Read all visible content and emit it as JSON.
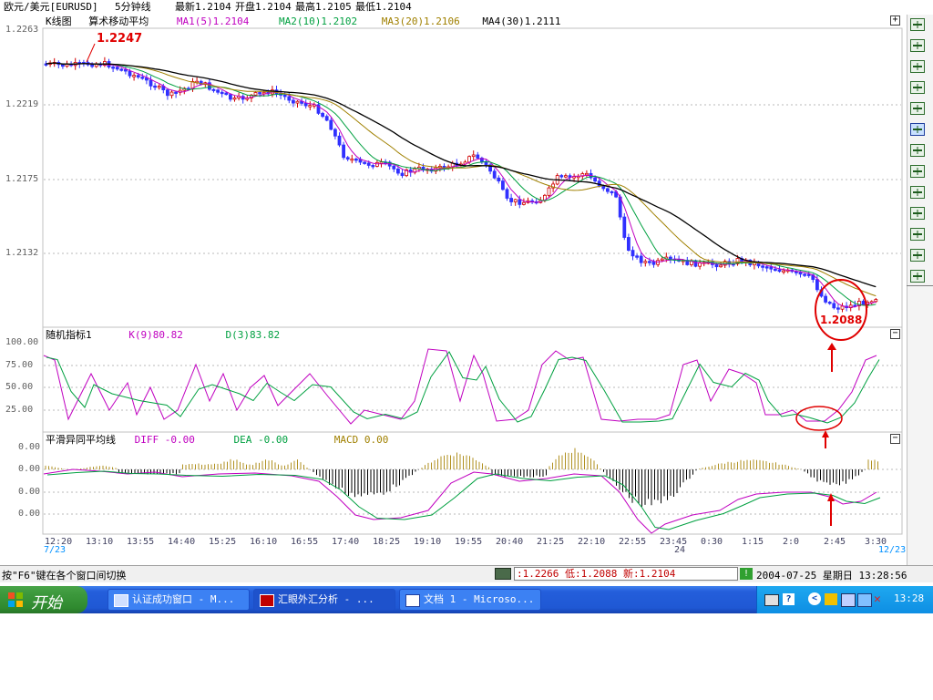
{
  "window": {
    "symbol": "欧元/美元[EURUSD]",
    "period": "5分钟线",
    "latest": "最新1.2104",
    "open": "开盘1.2104",
    "high": "最高1.2105",
    "low": "最低1.2104"
  },
  "kline": {
    "title": "K线图",
    "indicator": "算术移动平均",
    "ma1": "MA1(5)1.2104",
    "ma2": "MA2(10)1.2102",
    "ma3": "MA3(20)1.2106",
    "ma4": "MA4(30)1.2111",
    "annotation_high": "1.2247",
    "annotation_low": "1.2088",
    "y_ticks": [
      "1.2263",
      "1.2219",
      "1.2175",
      "1.2132"
    ]
  },
  "kdj": {
    "title": "随机指标1",
    "k": "K(9)80.82",
    "d": "D(3)83.82",
    "y_ticks": [
      "100.00",
      "75.00",
      "50.00",
      "25.00"
    ]
  },
  "macd": {
    "title": "平滑异同平均线",
    "diff": "DIFF -0.00",
    "dea": "DEA -0.00",
    "macd": "MACD 0.00",
    "y_ticks": [
      "0.00",
      "0.00",
      "0.00",
      "0.00"
    ]
  },
  "x_axis": {
    "labels": [
      "12:20",
      "13:10",
      "13:55",
      "14:40",
      "15:25",
      "16:10",
      "16:55",
      "17:40",
      "18:25",
      "19:10",
      "19:55",
      "20:40",
      "21:25",
      "22:10",
      "22:55",
      "23:45",
      "0:30",
      "1:15",
      "2:0",
      "2:45",
      "3:30"
    ],
    "date_start": "7/23",
    "date_mid": "24",
    "date_end": "12/23"
  },
  "status": {
    "hint": "按\"F6\"键在各个窗口间切换",
    "quote": ":1.2266 低:1.2088 新:1.2104",
    "datetime": "2004-07-25 星期日 13:28:56"
  },
  "taskbar": {
    "start": "开始",
    "tasks": [
      "认证成功窗口 - M...",
      "汇眼外汇分析 - ...",
      "文档 1 - Microso..."
    ],
    "clock": "13:28"
  },
  "colors": {
    "ma1": "#c000c0",
    "ma2": "#00a040",
    "ma3": "#a08000",
    "ma4": "#000000",
    "up": "#d00000",
    "down": "#3030ff",
    "annotation": "#e00000"
  },
  "icons": [
    "cursor-icon",
    "zoom-icon",
    "line-icon",
    "trend-icon",
    "channel-icon",
    "fib-icon",
    "pen-icon",
    "bars-icon",
    "candle-icon",
    "volume-icon",
    "grid-icon",
    "text-icon",
    "delete-icon"
  ]
}
